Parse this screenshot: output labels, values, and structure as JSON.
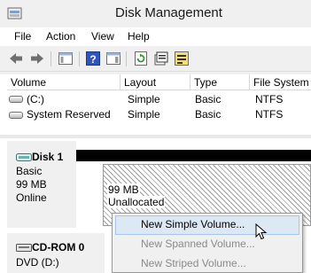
{
  "window": {
    "title": "Disk Management"
  },
  "menu": [
    "File",
    "Action",
    "View",
    "Help"
  ],
  "toolbar": {
    "icons": [
      "back-arrow-icon",
      "forward-arrow-icon",
      "show-hide-console-tree-icon",
      "help-icon",
      "show-hide-action-pane-icon",
      "refresh-icon",
      "properties-icon",
      "disk-list-icon"
    ]
  },
  "volumes": {
    "columns": [
      "Volume",
      "Layout",
      "Type",
      "File System"
    ],
    "rows": [
      {
        "volume": "(C:)",
        "layout": "Simple",
        "type": "Basic",
        "fs": "NTFS"
      },
      {
        "volume": "System Reserved",
        "layout": "Simple",
        "type": "Basic",
        "fs": "NTFS"
      }
    ]
  },
  "disks": [
    {
      "name": "Disk 1",
      "kind": "Basic",
      "size": "99 MB",
      "status": "Online",
      "partition": {
        "size": "99 MB",
        "state": "Unallocated"
      }
    },
    {
      "name": "CD-ROM 0",
      "kind": "DVD (D:)"
    }
  ],
  "context_menu": [
    {
      "label": "New Simple Volume...",
      "enabled": true,
      "highlighted": true
    },
    {
      "label": "New Spanned Volume...",
      "enabled": false
    },
    {
      "label": "New Striped Volume...",
      "enabled": false
    }
  ]
}
